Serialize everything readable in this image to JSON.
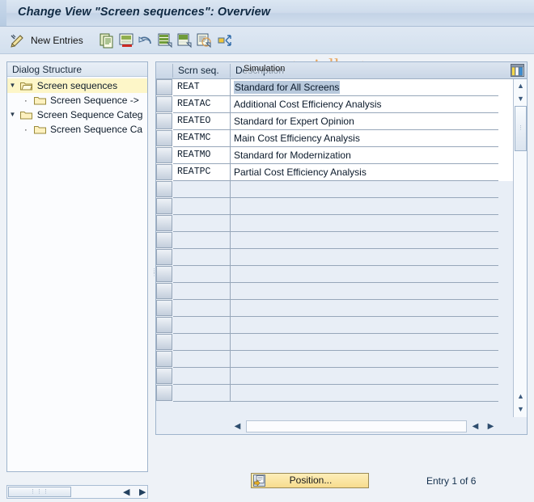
{
  "window": {
    "title": "Change View \"Screen sequences\": Overview"
  },
  "watermark": {
    "text": "www.tutorialkart.com",
    "color": "#e8a863"
  },
  "toolbar": {
    "icons": [
      {
        "name": "check-pencil-icon",
        "glyph": "✎"
      },
      {
        "name": "copy-icon",
        "glyph": "❐"
      },
      {
        "name": "delete-row-icon",
        "glyph": "▤"
      },
      {
        "name": "undo-icon",
        "glyph": "↶"
      },
      {
        "name": "select-all-icon",
        "glyph": "▦"
      },
      {
        "name": "deselect-all-icon",
        "glyph": "▧"
      },
      {
        "name": "details-icon",
        "glyph": "☰"
      },
      {
        "name": "simulation-icon",
        "glyph": "✣"
      }
    ],
    "new_entries_label": "New Entries",
    "simulation_label": "Simulation"
  },
  "tree": {
    "header": "Dialog Structure",
    "items": [
      {
        "label": "Screen sequences",
        "level": 0,
        "expanded": true,
        "selected": true,
        "icon": "open-folder-icon"
      },
      {
        "label": "Screen Sequence ->",
        "level": 1,
        "expanded": false,
        "selected": false,
        "icon": "folder-icon"
      },
      {
        "label": "Screen Sequence Categ",
        "level": 0,
        "expanded": true,
        "selected": false,
        "icon": "folder-icon"
      },
      {
        "label": "Screen Sequence Ca",
        "level": 1,
        "expanded": false,
        "selected": false,
        "icon": "folder-icon"
      }
    ]
  },
  "table": {
    "columns": [
      "Scrn seq.",
      "Description"
    ],
    "rows": [
      {
        "code": "REAT",
        "description": "Standard for All Screens",
        "highlighted": true
      },
      {
        "code": "REATAC",
        "description": "Additional Cost Efficiency Analysis",
        "highlighted": false
      },
      {
        "code": "REATEO",
        "description": "Standard for Expert Opinion",
        "highlighted": false
      },
      {
        "code": "REATMC",
        "description": "Main Cost Efficiency Analysis",
        "highlighted": false
      },
      {
        "code": "REATMO",
        "description": "Standard for Modernization",
        "highlighted": false
      },
      {
        "code": "REATPC",
        "description": "Partial Cost Efficiency Analysis",
        "highlighted": false
      }
    ],
    "empty_row_count": 14,
    "config_icon": "table-settings-icon"
  },
  "footer": {
    "position_button_label": "Position...",
    "entry_status": "Entry 1 of 6"
  },
  "scrollbars": {
    "up_arrow": "▲",
    "down_arrow": "▼",
    "left_arrow": "◀",
    "right_arrow": "▶",
    "grip": "⋮"
  }
}
